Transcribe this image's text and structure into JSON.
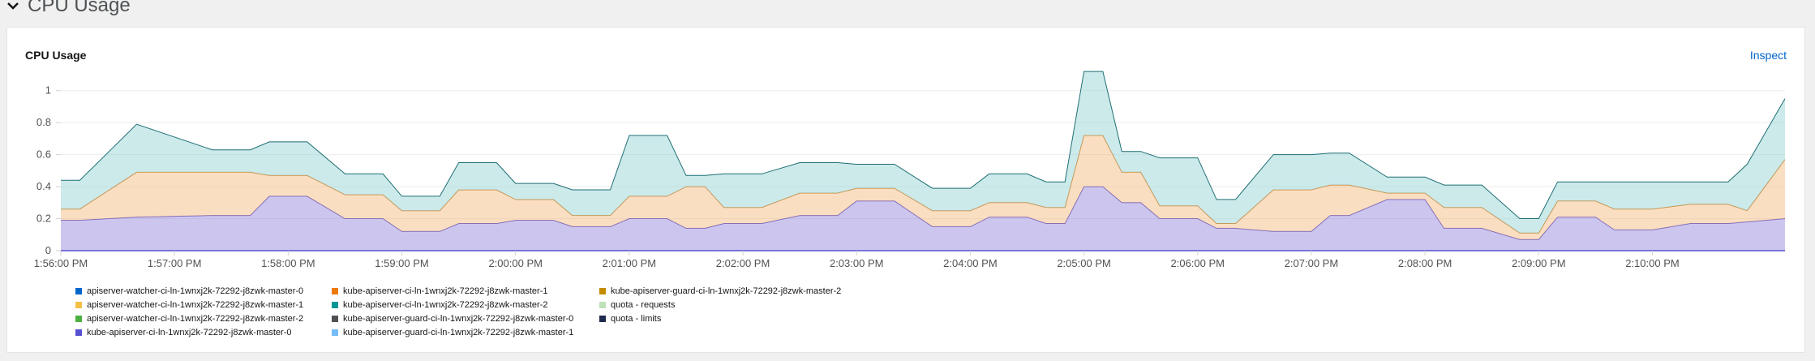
{
  "section": {
    "title": "CPU Usage",
    "icon": "chevron-down-icon"
  },
  "card": {
    "title": "CPU Usage",
    "inspect_label": "Inspect"
  },
  "chart_data": {
    "type": "area",
    "stacked": true,
    "x": [
      "1:56:00 PM",
      "1:56:10 PM",
      "1:56:40 PM",
      "1:57:20 PM",
      "1:57:40 PM",
      "1:57:50 PM",
      "1:58:10 PM",
      "1:58:30 PM",
      "1:58:50 PM",
      "1:59:00 PM",
      "1:59:20 PM",
      "1:59:30 PM",
      "1:59:50 PM",
      "2:00:00 PM",
      "2:00:20 PM",
      "2:00:30 PM",
      "2:00:50 PM",
      "2:01:00 PM",
      "2:01:20 PM",
      "2:01:30 PM",
      "2:01:40 PM",
      "2:01:50 PM",
      "2:02:10 PM",
      "2:02:30 PM",
      "2:02:50 PM",
      "2:03:00 PM",
      "2:03:20 PM",
      "2:03:40 PM",
      "2:04:00 PM",
      "2:04:10 PM",
      "2:04:30 PM",
      "2:04:40 PM",
      "2:04:50 PM",
      "2:05:00 PM",
      "2:05:10 PM",
      "2:05:20 PM",
      "2:05:30 PM",
      "2:05:40 PM",
      "2:06:00 PM",
      "2:06:10 PM",
      "2:06:20 PM",
      "2:06:40 PM",
      "2:07:00 PM",
      "2:07:10 PM",
      "2:07:20 PM",
      "2:07:40 PM",
      "2:08:00 PM",
      "2:08:10 PM",
      "2:08:30 PM",
      "2:08:50 PM",
      "2:09:00 PM",
      "2:09:10 PM",
      "2:09:30 PM",
      "2:09:40 PM",
      "2:10:00 PM",
      "2:10:20 PM",
      "2:10:40 PM",
      "2:10:50 PM",
      "2:11:10 PM"
    ],
    "x_ticks": [
      "1:56:00 PM",
      "1:57:00 PM",
      "1:58:00 PM",
      "1:59:00 PM",
      "2:00:00 PM",
      "2:01:00 PM",
      "2:02:00 PM",
      "2:03:00 PM",
      "2:04:00 PM",
      "2:05:00 PM",
      "2:06:00 PM",
      "2:07:00 PM",
      "2:08:00 PM",
      "2:09:00 PM",
      "2:10:00 PM"
    ],
    "y_ticks": [
      "0",
      "0.2",
      "0.4",
      "0.6",
      "0.8",
      "1"
    ],
    "ylim": [
      0,
      1.1
    ],
    "grid": true,
    "series": [
      {
        "name": "kube-apiserver-ci-ln-1wnxj2k-72292-j8zwk-master-0",
        "color": "#8f80dc",
        "values": [
          0.19,
          0.19,
          0.21,
          0.22,
          0.22,
          0.34,
          0.34,
          0.2,
          0.2,
          0.12,
          0.12,
          0.17,
          0.17,
          0.19,
          0.19,
          0.15,
          0.15,
          0.2,
          0.2,
          0.14,
          0.14,
          0.17,
          0.17,
          0.22,
          0.22,
          0.31,
          0.31,
          0.15,
          0.15,
          0.21,
          0.21,
          0.17,
          0.17,
          0.4,
          0.4,
          0.3,
          0.3,
          0.2,
          0.2,
          0.14,
          0.14,
          0.12,
          0.12,
          0.22,
          0.22,
          0.32,
          0.32,
          0.14,
          0.14,
          0.07,
          0.07,
          0.21,
          0.21,
          0.13,
          0.13,
          0.17,
          0.17,
          0.18,
          0.2
        ]
      },
      {
        "name": "kube-apiserver-ci-ln-1wnxj2k-72292-j8zwk-master-1",
        "color": "#f4b678",
        "values": [
          0.07,
          0.07,
          0.28,
          0.27,
          0.27,
          0.13,
          0.13,
          0.15,
          0.15,
          0.13,
          0.13,
          0.21,
          0.21,
          0.13,
          0.13,
          0.07,
          0.07,
          0.14,
          0.14,
          0.26,
          0.26,
          0.1,
          0.1,
          0.14,
          0.14,
          0.08,
          0.08,
          0.1,
          0.1,
          0.09,
          0.09,
          0.1,
          0.1,
          0.32,
          0.32,
          0.19,
          0.19,
          0.08,
          0.08,
          0.03,
          0.03,
          0.26,
          0.26,
          0.19,
          0.19,
          0.04,
          0.04,
          0.13,
          0.13,
          0.04,
          0.04,
          0.1,
          0.1,
          0.13,
          0.13,
          0.12,
          0.12,
          0.07,
          0.37
        ]
      },
      {
        "name": "kube-apiserver-ci-ln-1wnxj2k-72292-j8zwk-master-2",
        "color": "#8fd1d0",
        "values": [
          0.18,
          0.18,
          0.3,
          0.14,
          0.14,
          0.21,
          0.21,
          0.13,
          0.13,
          0.09,
          0.09,
          0.17,
          0.17,
          0.1,
          0.1,
          0.16,
          0.16,
          0.38,
          0.38,
          0.07,
          0.07,
          0.21,
          0.21,
          0.19,
          0.19,
          0.15,
          0.15,
          0.14,
          0.14,
          0.18,
          0.18,
          0.16,
          0.16,
          0.4,
          0.4,
          0.13,
          0.13,
          0.3,
          0.3,
          0.15,
          0.15,
          0.22,
          0.22,
          0.2,
          0.2,
          0.1,
          0.1,
          0.14,
          0.14,
          0.09,
          0.09,
          0.12,
          0.12,
          0.17,
          0.17,
          0.14,
          0.14,
          0.29,
          0.38
        ]
      }
    ],
    "legend": [
      {
        "label": "apiserver-watcher-ci-ln-1wnxj2k-72292-j8zwk-master-0",
        "color": "#0066cc"
      },
      {
        "label": "kube-apiserver-ci-ln-1wnxj2k-72292-j8zwk-master-1",
        "color": "#ec7a08"
      },
      {
        "label": "kube-apiserver-guard-ci-ln-1wnxj2k-72292-j8zwk-master-2",
        "color": "#c58c00"
      },
      {
        "label": "apiserver-watcher-ci-ln-1wnxj2k-72292-j8zwk-master-1",
        "color": "#f4c145"
      },
      {
        "label": "kube-apiserver-ci-ln-1wnxj2k-72292-j8zwk-master-2",
        "color": "#009596"
      },
      {
        "label": "quota - requests",
        "color": "#bde2b9"
      },
      {
        "label": "apiserver-watcher-ci-ln-1wnxj2k-72292-j8zwk-master-2",
        "color": "#4cb140"
      },
      {
        "label": "kube-apiserver-guard-ci-ln-1wnxj2k-72292-j8zwk-master-0",
        "color": "#4f5255"
      },
      {
        "label": "quota - limits",
        "color": "#1f2a4f"
      },
      {
        "label": "kube-apiserver-ci-ln-1wnxj2k-72292-j8zwk-master-0",
        "color": "#5752d1"
      },
      {
        "label": "kube-apiserver-guard-ci-ln-1wnxj2k-72292-j8zwk-master-1",
        "color": "#73bcf7"
      }
    ]
  }
}
